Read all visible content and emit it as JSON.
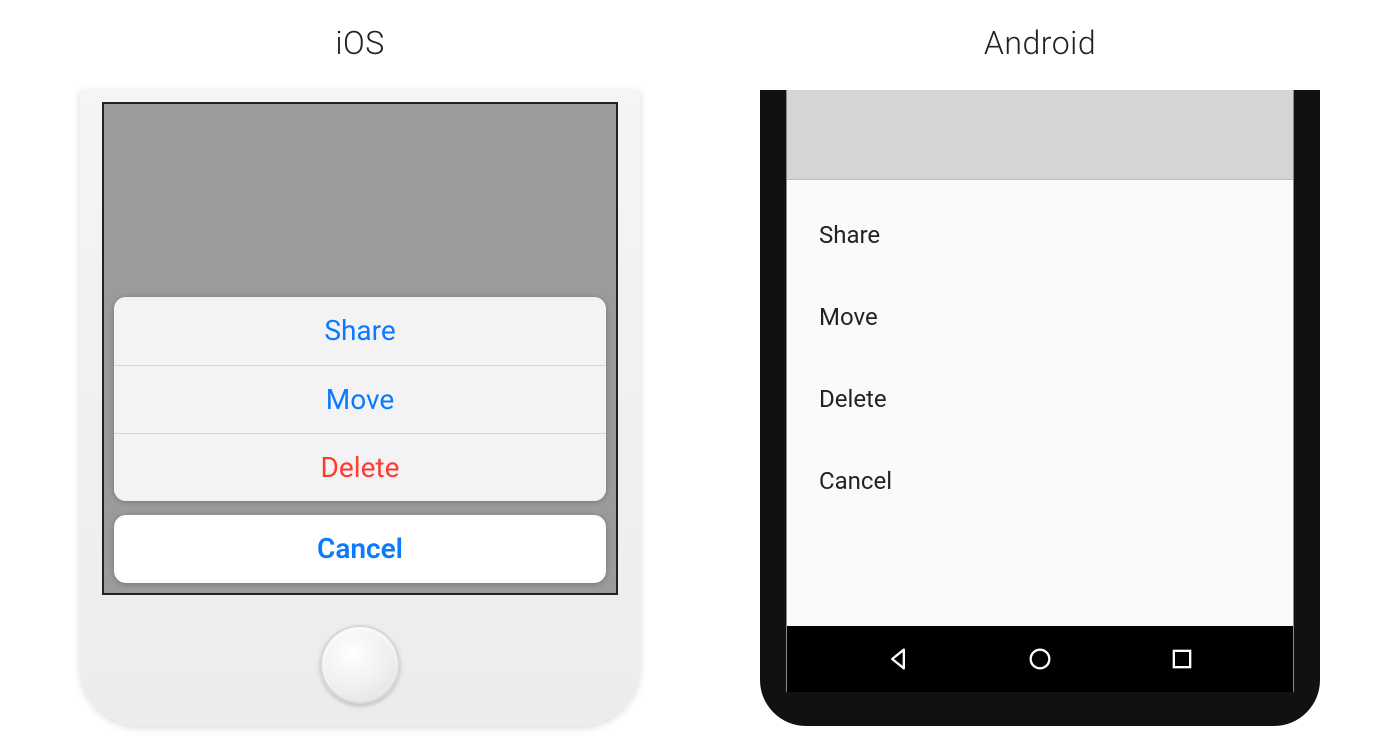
{
  "ios": {
    "label": "iOS",
    "actions": {
      "share": "Share",
      "move": "Move",
      "delete": "Delete"
    },
    "cancel": "Cancel"
  },
  "android": {
    "label": "Android",
    "actions": {
      "share": "Share",
      "move": "Move",
      "delete": "Delete",
      "cancel": "Cancel"
    }
  }
}
